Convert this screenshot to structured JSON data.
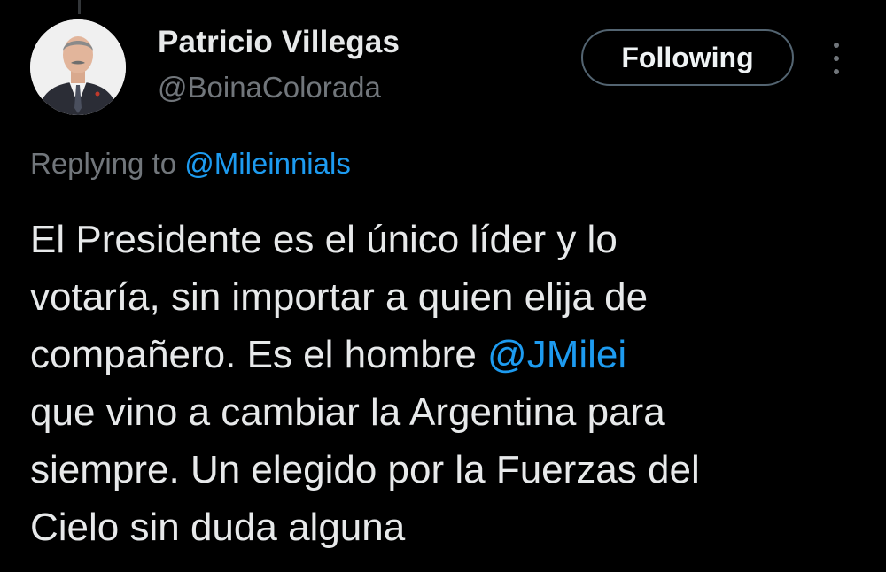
{
  "author": {
    "display_name": "Patricio Villegas",
    "handle": "@BoinaColorada"
  },
  "follow_button": {
    "label": "Following"
  },
  "more_menu": {
    "icon": "more-vertical-icon"
  },
  "reply_context": {
    "prefix": "Replying to ",
    "mention": "@Mileinnials"
  },
  "tweet": {
    "line_1": "El Presidente es el único líder y lo",
    "line_2": "votaría, sin importar a quien elija de",
    "line_3_text": "compañero. Es el hombre ",
    "line_3_mention": "@JMilei",
    "line_4": "que vino a cambiar la Argentina para",
    "line_5": "siempre. Un elegido por la Fuerzas del",
    "line_6": "Cielo sin duda alguna"
  },
  "colors": {
    "background": "#000000",
    "primary_text": "#e7e9ea",
    "secondary_text": "#71767b",
    "accent": "#1d9bf0",
    "button_border": "#536471"
  }
}
